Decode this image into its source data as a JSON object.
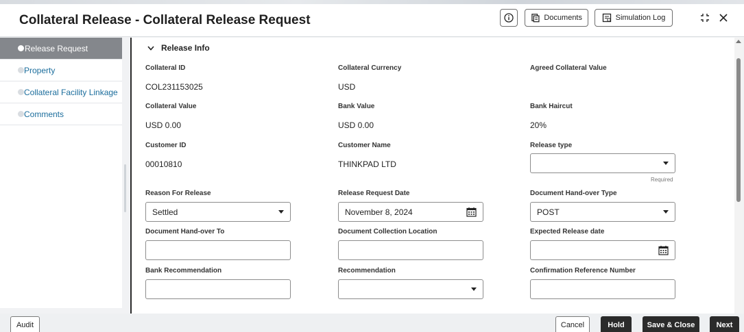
{
  "header": {
    "title": "Collateral Release - Collateral Release Request",
    "documents_label": "Documents",
    "simulation_label": "Simulation Log"
  },
  "sidebar": {
    "items": [
      {
        "label": "Release Request",
        "active": true
      },
      {
        "label": "Property",
        "active": false
      },
      {
        "label": "Collateral Facility Linkage",
        "active": false
      },
      {
        "label": "Comments",
        "active": false
      }
    ]
  },
  "section": {
    "title": "Release Info"
  },
  "fields": {
    "collateral_id": {
      "label": "Collateral ID",
      "value": "COL231153025"
    },
    "collateral_currency": {
      "label": "Collateral Currency",
      "value": "USD"
    },
    "agreed_collateral_value": {
      "label": "Agreed Collateral Value",
      "value": ""
    },
    "collateral_value": {
      "label": "Collateral Value",
      "value": "USD 0.00"
    },
    "bank_value": {
      "label": "Bank Value",
      "value": "USD 0.00"
    },
    "bank_haircut": {
      "label": "Bank Haircut",
      "value": "20%"
    },
    "customer_id": {
      "label": "Customer ID",
      "value": "00010810"
    },
    "customer_name": {
      "label": "Customer Name",
      "value": "THINKPAD LTD"
    },
    "release_type": {
      "label": "Release type",
      "value": "",
      "hint": "Required"
    },
    "reason_for_release": {
      "label": "Reason For Release",
      "value": "Settled"
    },
    "release_request_date": {
      "label": "Release Request Date",
      "value": "November 8, 2024"
    },
    "document_handover_type": {
      "label": "Document Hand-over Type",
      "value": "POST"
    },
    "document_handover_to": {
      "label": "Document Hand-over To",
      "value": ""
    },
    "document_collection_location": {
      "label": "Document Collection Location",
      "value": ""
    },
    "expected_release_date": {
      "label": "Expected Release date",
      "value": ""
    },
    "bank_recommendation": {
      "label": "Bank Recommendation",
      "value": ""
    },
    "recommendation": {
      "label": "Recommendation",
      "value": ""
    },
    "confirmation_reference_number": {
      "label": "Confirmation Reference Number",
      "value": ""
    }
  },
  "footer": {
    "audit_label": "Audit",
    "cancel_label": "Cancel",
    "hold_label": "Hold",
    "save_close_label": "Save & Close",
    "next_label": "Next"
  },
  "icons": {
    "info": "info-icon",
    "documents": "documents-icon",
    "simulation": "simulation-log-icon",
    "collapse": "collapse-icon",
    "close": "close-icon",
    "chevron": "chevron-down-icon",
    "calendar": "calendar-icon"
  }
}
